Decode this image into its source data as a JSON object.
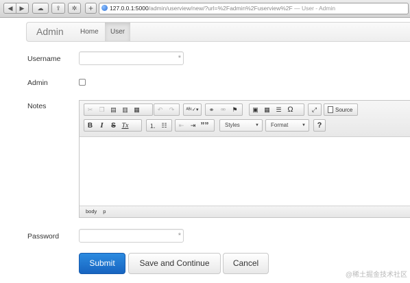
{
  "browser": {
    "url_host": "127.0.0.1:5000",
    "url_path": "/admin/userview/new/?url=%2Fadmin%2Fuserview%2F",
    "page_title": " — User - Admin"
  },
  "navbar": {
    "brand": "Admin",
    "items": [
      {
        "label": "Home",
        "active": false
      },
      {
        "label": "User",
        "active": true
      }
    ]
  },
  "form": {
    "username_label": "Username",
    "username_value": "",
    "admin_label": "Admin",
    "admin_checked": false,
    "notes_label": "Notes",
    "password_label": "Password",
    "password_value": "",
    "required_marker": "*"
  },
  "editor": {
    "source_label": "Source",
    "styles_label": "Styles",
    "format_label": "Format",
    "help_label": "?",
    "bold_label": "B",
    "italic_label": "I",
    "strike_label": "S",
    "remove_format_label": "Tx",
    "quote_label": "””",
    "omega_label": "Ω",
    "path": [
      "body",
      "p"
    ]
  },
  "buttons": {
    "submit": "Submit",
    "save_continue": "Save and Continue",
    "cancel": "Cancel"
  },
  "watermark": "@稀土掘金技术社区",
  "colors": {
    "primary": "#1f75cc",
    "navbar_bg": "#f5f5f5"
  }
}
